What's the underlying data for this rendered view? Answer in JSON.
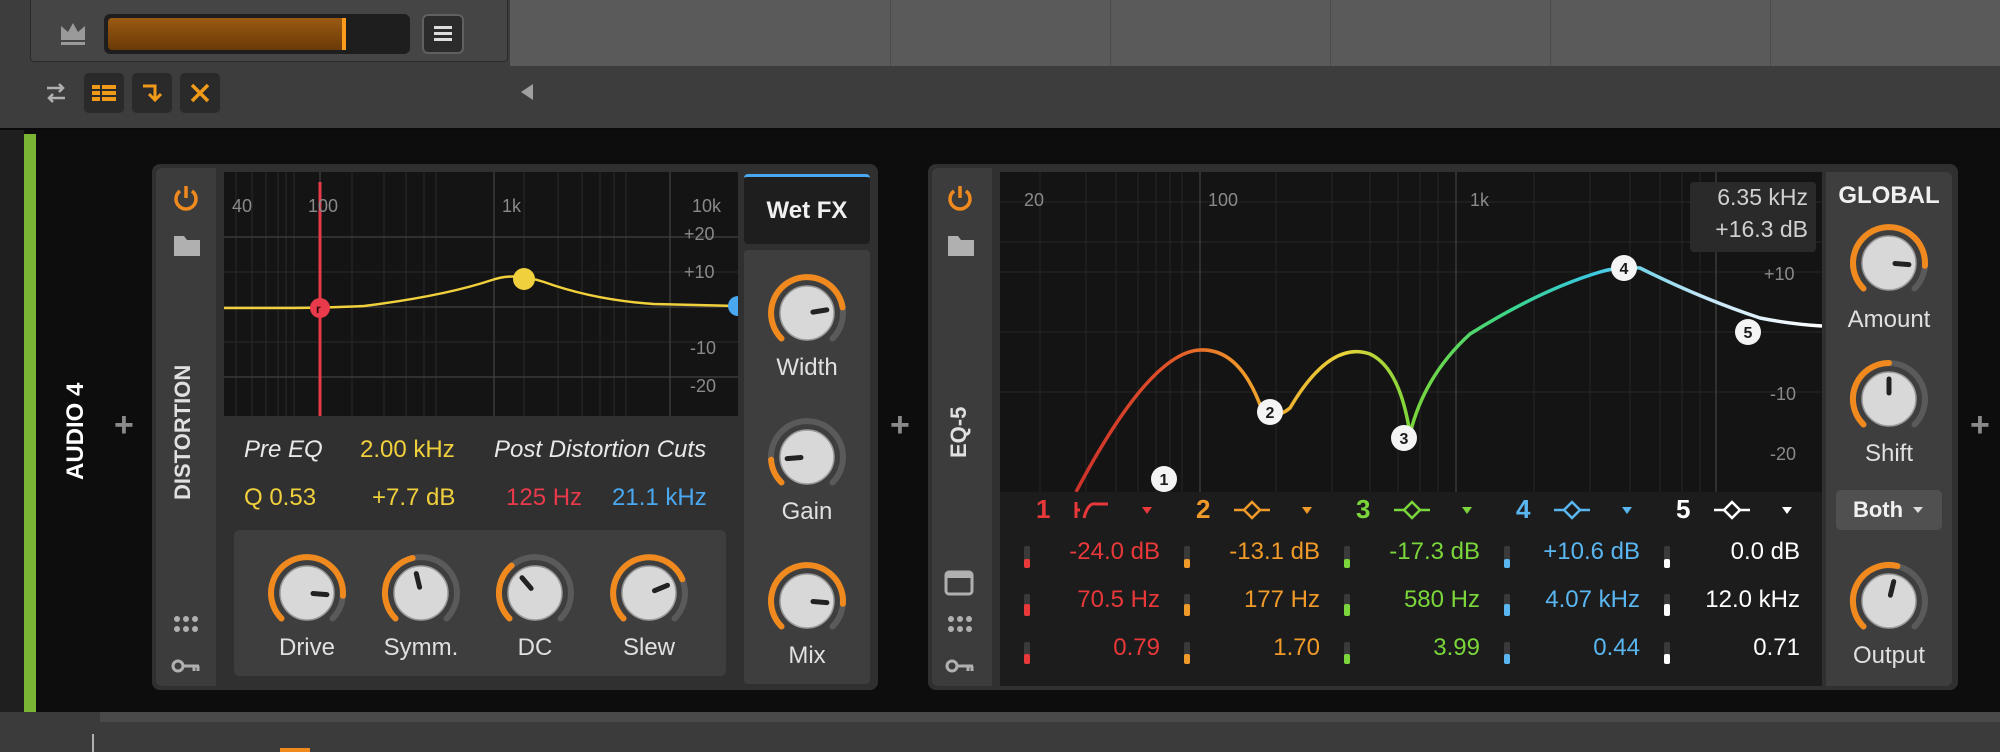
{
  "track": {
    "name": "AUDIO 4",
    "color": "#7ab534"
  },
  "toolbar": {
    "icons": [
      "swap-icon",
      "list-icon",
      "collapse-arrow-icon",
      "close-x-icon"
    ],
    "collapse_icon": "triangle-left-icon"
  },
  "top_widget": {
    "crown_icon": "crown-icon",
    "menu_icon": "menu-icon"
  },
  "add_device_symbol": "+",
  "distortion": {
    "title": "DISTORTION",
    "freq_ticks": [
      "40",
      "100",
      "1k",
      "10k"
    ],
    "db_ticks": [
      "+20",
      "+10",
      "-10",
      "-20"
    ],
    "pre_eq_label": "Pre EQ",
    "pre_eq_freq": "2.00 kHz",
    "post_label": "Post Distortion Cuts",
    "q_value": "Q 0.53",
    "gain_value": "+7.7 dB",
    "low_cut": "125 Hz",
    "high_cut": "21.1 kHz",
    "knobs": [
      {
        "label": "Drive",
        "value": 0.85
      },
      {
        "label": "Symm.",
        "value": 0.45
      },
      {
        "label": "DC",
        "value": 0.35
      },
      {
        "label": "Slew",
        "value": 0.75
      }
    ],
    "wet_fx": "Wet FX",
    "side_knobs": [
      {
        "label": "Width",
        "value": 0.8
      },
      {
        "label": "Gain",
        "value": 0.15
      },
      {
        "label": "Mix",
        "value": 0.85
      }
    ],
    "colors": {
      "accent": "#f08a1e",
      "pre": "#f0d03c",
      "cut_low": "#e83a4a",
      "cut_high": "#4aa8f0"
    }
  },
  "eq5": {
    "title": "EQ-5",
    "freq_ticks": [
      "20",
      "100",
      "1k"
    ],
    "db_ticks": [
      "+10",
      "-10",
      "-20"
    ],
    "readout_freq": "6.35 kHz",
    "readout_gain": "+16.3 dB",
    "bands": [
      {
        "num": "1",
        "color": "#e8383a",
        "gain": "-24.0 dB",
        "freq": "70.5 Hz",
        "q": "0.79"
      },
      {
        "num": "2",
        "color": "#f09a2a",
        "gain": "-13.1 dB",
        "freq": "177 Hz",
        "q": "1.70"
      },
      {
        "num": "3",
        "color": "#7ad63a",
        "gain": "-17.3 dB",
        "freq": "580 Hz",
        "q": "3.99"
      },
      {
        "num": "4",
        "color": "#5ab6f0",
        "gain": "+10.6 dB",
        "freq": "4.07 kHz",
        "q": "0.44"
      },
      {
        "num": "5",
        "color": "#ffffff",
        "gain": "0.0 dB",
        "freq": "12.0 kHz",
        "q": "0.71"
      }
    ],
    "global": {
      "title": "GLOBAL",
      "amount_label": "Amount",
      "shift_label": "Shift",
      "both_label": "Both",
      "output_label": "Output",
      "amount_value": 0.85,
      "shift_value": 0.5,
      "output_value": 0.55
    }
  }
}
